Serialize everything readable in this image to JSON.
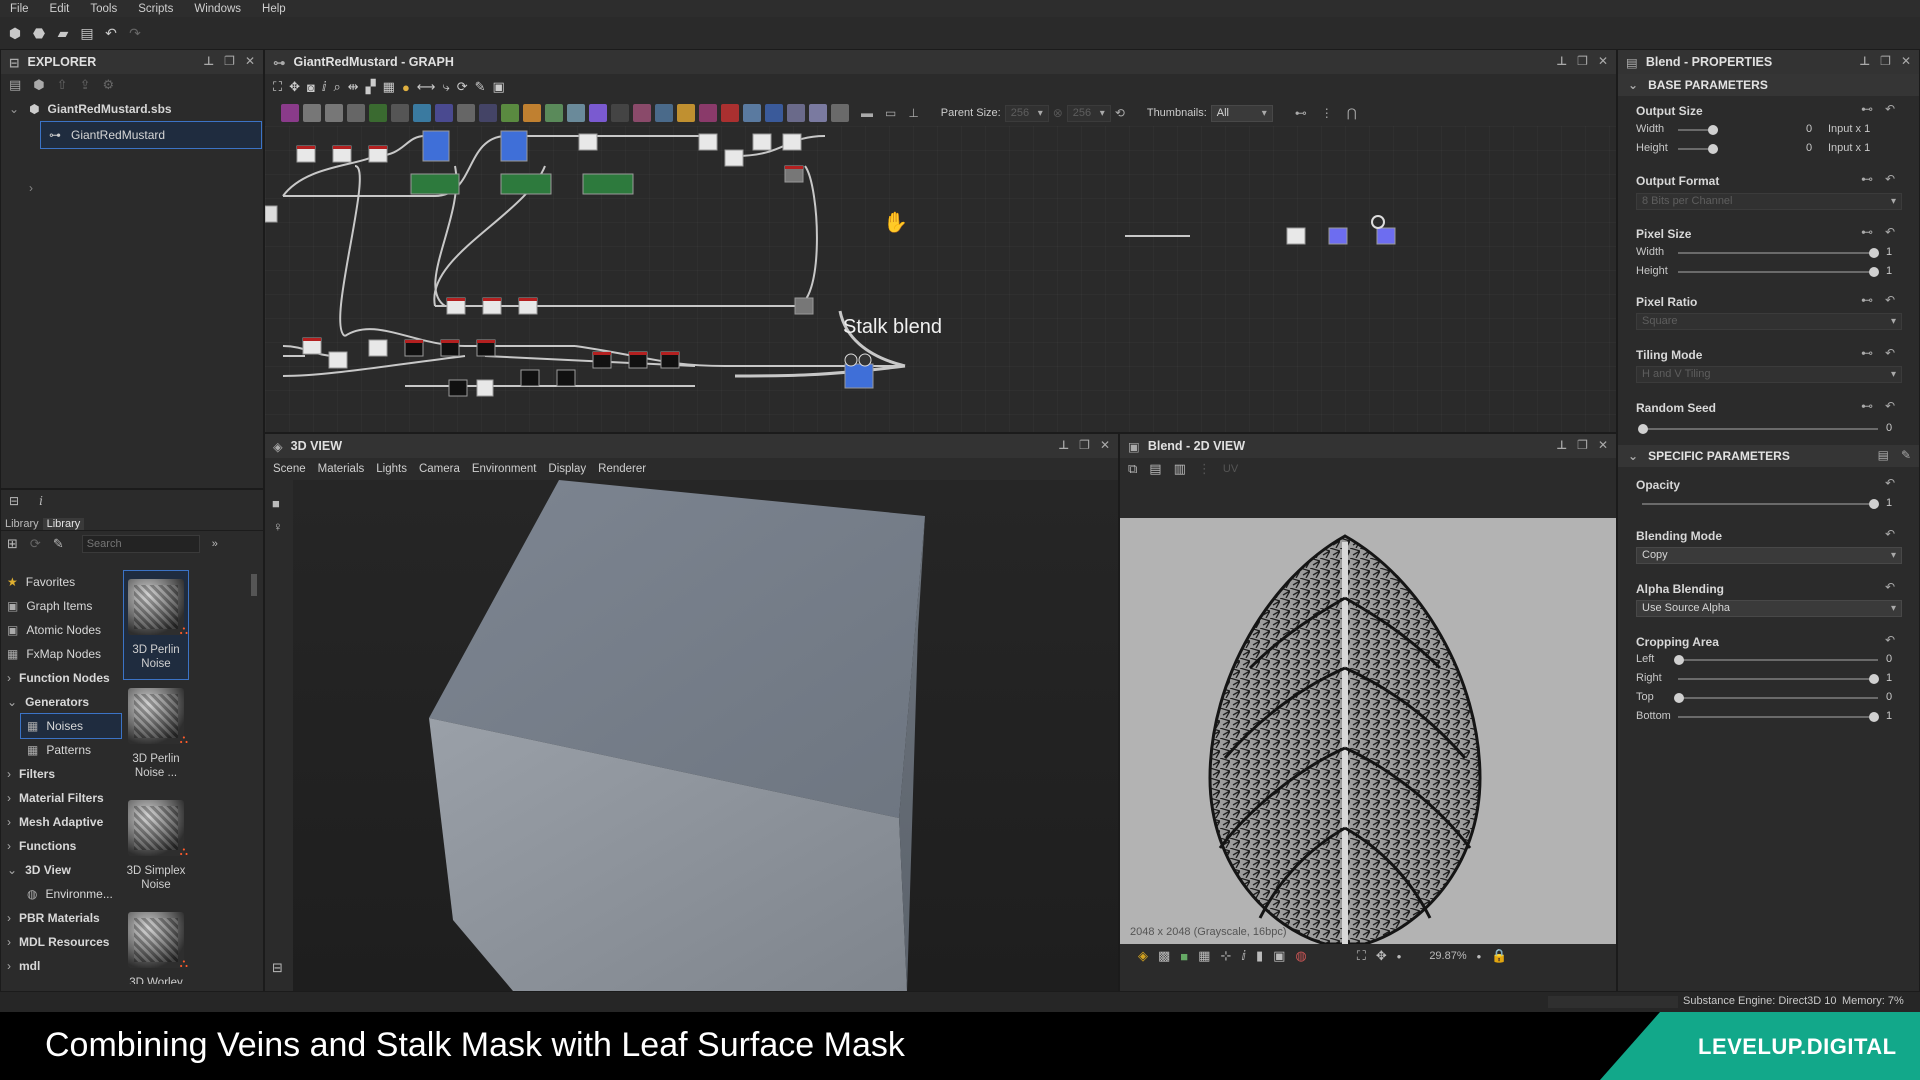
{
  "menu": [
    "File",
    "Edit",
    "Tools",
    "Scripts",
    "Windows",
    "Help"
  ],
  "explorer": {
    "title": "EXPLORER",
    "package": "GiantRedMustard.sbs",
    "graph_item": "GiantRedMustard"
  },
  "library": {
    "tabs": [
      "Library",
      "Library"
    ],
    "search_placeholder": "Search",
    "categories": [
      {
        "label": "Favorites",
        "bold": false,
        "prefix": "★"
      },
      {
        "label": "Graph Items",
        "bold": false,
        "prefix": "▣"
      },
      {
        "label": "Atomic Nodes",
        "bold": false,
        "prefix": "▣"
      },
      {
        "label": "FxMap Nodes",
        "bold": false,
        "prefix": "▦"
      },
      {
        "label": "Function Nodes",
        "bold": true,
        "prefix": "›"
      },
      {
        "label": "Generators",
        "bold": true,
        "prefix": "⌄"
      },
      {
        "label": "Noises",
        "bold": false,
        "prefix": "▦"
      },
      {
        "label": "Patterns",
        "bold": false,
        "prefix": "▦"
      },
      {
        "label": "Filters",
        "bold": true,
        "prefix": "›"
      },
      {
        "label": "Material Filters",
        "bold": true,
        "prefix": "›"
      },
      {
        "label": "Mesh Adaptive",
        "bold": true,
        "prefix": "›"
      },
      {
        "label": "Functions",
        "bold": true,
        "prefix": "›"
      },
      {
        "label": "3D View",
        "bold": true,
        "prefix": "⌄"
      },
      {
        "label": "Environme...",
        "bold": false,
        "prefix": "◍"
      },
      {
        "label": "PBR Materials",
        "bold": true,
        "prefix": "›"
      },
      {
        "label": "MDL Resources",
        "bold": true,
        "prefix": "›"
      },
      {
        "label": "mdl",
        "bold": true,
        "prefix": "›"
      }
    ],
    "thumbnails": [
      {
        "label": "3D Perlin Noise"
      },
      {
        "label": "3D Perlin Noise ..."
      },
      {
        "label": "3D Simplex Noise"
      },
      {
        "label": "3D Worley"
      }
    ]
  },
  "graph": {
    "title": "GiantRedMustard - GRAPH",
    "parent_size_label": "Parent Size:",
    "parent_size_value": "256",
    "parent_size_value2": "256",
    "thumbnails_label": "Thumbnails:",
    "thumbnails_value": "All",
    "comment_label": "Stalk blend"
  },
  "view3d": {
    "title": "3D VIEW",
    "menu": [
      "Scene",
      "Materials",
      "Lights",
      "Camera",
      "Environment",
      "Display",
      "Renderer"
    ]
  },
  "view2d": {
    "title": "Blend - 2D VIEW",
    "uv_label": "UV",
    "resolution_text": "2048 x 2048 (Grayscale, 16bpc)",
    "zoom": "29.87%"
  },
  "properties": {
    "title": "Blend - PROPERTIES",
    "base_section": "BASE PARAMETERS",
    "specific_section": "SPECIFIC PARAMETERS",
    "output_size": {
      "label": "Output Size",
      "width_label": "Width",
      "height_label": "Height",
      "width_val": "0",
      "height_val": "0",
      "width_mode": "Input x 1",
      "height_mode": "Input x 1"
    },
    "output_format": {
      "label": "Output Format",
      "value": "8 Bits per Channel"
    },
    "pixel_size": {
      "label": "Pixel Size",
      "width_label": "Width",
      "height_label": "Height",
      "width_val": "1",
      "height_val": "1"
    },
    "pixel_ratio": {
      "label": "Pixel Ratio",
      "value": "Square"
    },
    "tiling_mode": {
      "label": "Tiling Mode",
      "value": "H and V Tiling"
    },
    "random_seed": {
      "label": "Random Seed",
      "value": "0"
    },
    "opacity": {
      "label": "Opacity",
      "value": "1"
    },
    "blending_mode": {
      "label": "Blending Mode",
      "value": "Copy"
    },
    "alpha_blending": {
      "label": "Alpha Blending",
      "value": "Use Source Alpha"
    },
    "cropping": {
      "label": "Cropping Area",
      "left_label": "Left",
      "right_label": "Right",
      "top_label": "Top",
      "bottom_label": "Bottom",
      "left": "0",
      "right": "1",
      "top": "0",
      "bottom": "1"
    }
  },
  "status": {
    "engine": "Substance Engine: Direct3D 10",
    "memory": "Memory: 7%"
  },
  "banner": {
    "caption": "Combining Veins and Stalk Mask with Leaf Surface Mask",
    "brand": "LEVELUP.DIGITAL"
  },
  "colors": {
    "accent": "#3b73c6",
    "brand": "#12a88a",
    "node_blue": "#3f6fd8",
    "node_red": "#b32020",
    "node_green": "#2d7a3d"
  }
}
